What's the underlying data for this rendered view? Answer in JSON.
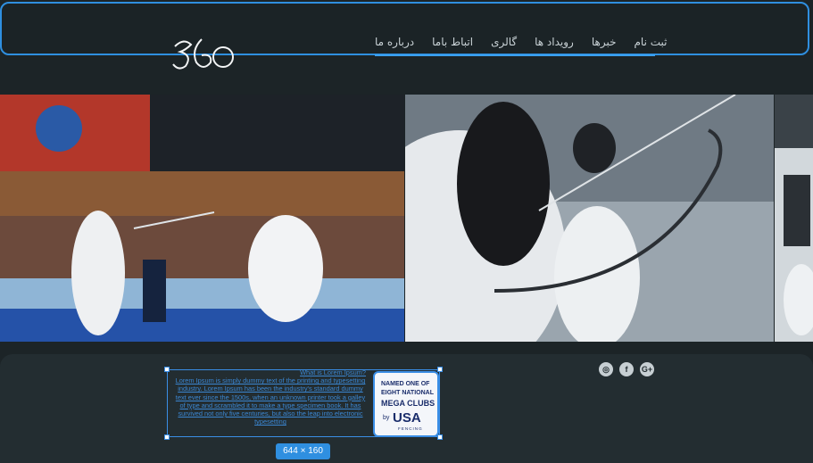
{
  "header": {
    "logo_text": "360",
    "nav": [
      {
        "label": "درباره ما"
      },
      {
        "label": "اتباط باما"
      },
      {
        "label": "گالری"
      },
      {
        "label": "رویداد ها"
      },
      {
        "label": "خبرها"
      },
      {
        "label": "ثبت نام"
      }
    ]
  },
  "footer": {
    "text_heading": "What is Lorem Ipsum?",
    "text_body": "Lorem Ipsum is simply dummy text of the printing and typesetting industry. Lorem Ipsum has been the industry's standard dummy text ever since the 1500s, when an unknown printer took a galley of type and scrambled it to make a type specimen book. It has survived not only five centuries, but also the leap into electronic typesetting",
    "badge": {
      "line1": "NAMED ONE OF",
      "line2": "EIGHT NATIONAL",
      "line3": "MEGA CLUBS",
      "by": "by",
      "usa": "USA",
      "fencing": "FENCING"
    },
    "selection_size": "644 × 160",
    "social": [
      {
        "icon": "instagram-icon",
        "glyph": "◎"
      },
      {
        "icon": "facebook-icon",
        "glyph": "f"
      },
      {
        "icon": "google-plus-icon",
        "glyph": "G+"
      }
    ]
  },
  "colors": {
    "accent": "#2f8fe0",
    "background": "#1c2427"
  }
}
